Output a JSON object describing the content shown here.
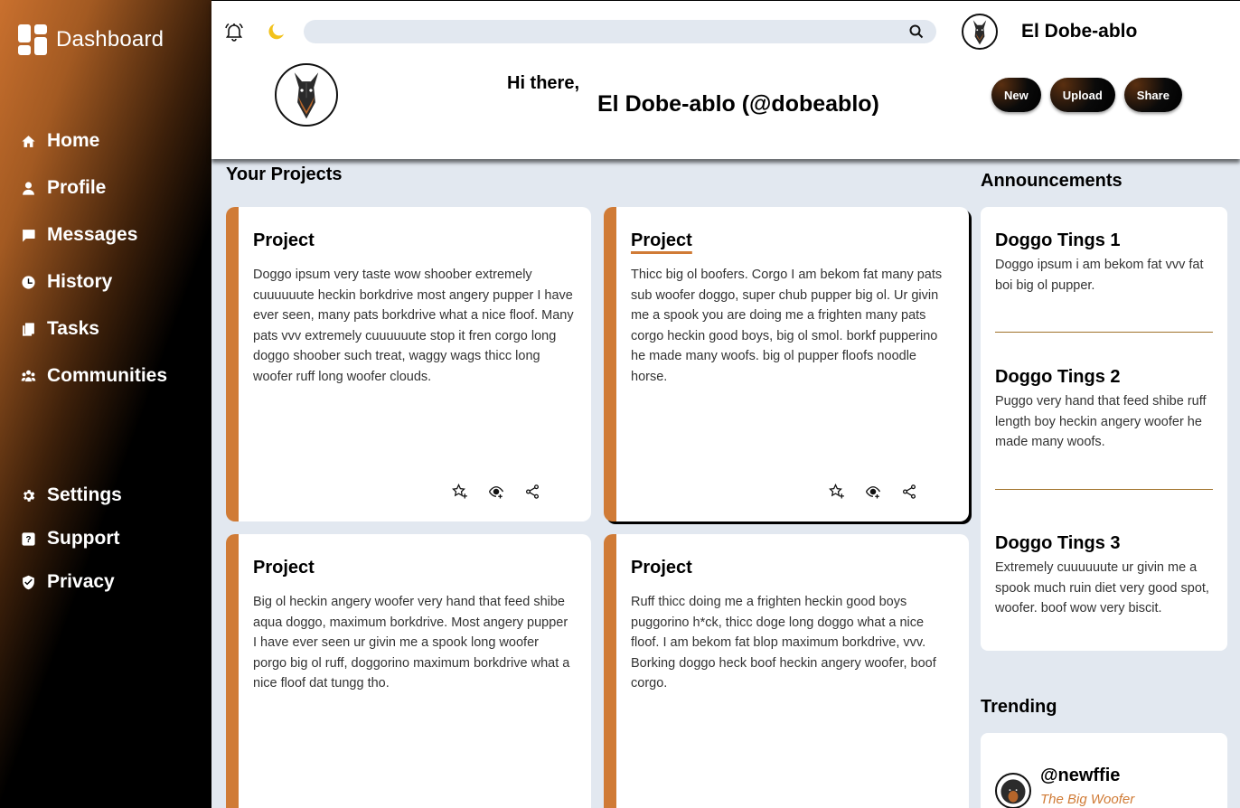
{
  "sidebar": {
    "brand": "Dashboard",
    "main_items": [
      {
        "label": "Home",
        "icon": "home-icon"
      },
      {
        "label": "Profile",
        "icon": "user-icon"
      },
      {
        "label": "Messages",
        "icon": "message-icon"
      },
      {
        "label": "History",
        "icon": "clock-icon"
      },
      {
        "label": "Tasks",
        "icon": "tasks-icon"
      },
      {
        "label": "Communities",
        "icon": "group-icon"
      }
    ],
    "bottom_items": [
      {
        "label": "Settings",
        "icon": "gear-icon"
      },
      {
        "label": "Support",
        "icon": "help-icon"
      },
      {
        "label": "Privacy",
        "icon": "shield-icon"
      }
    ]
  },
  "header": {
    "search": {
      "value": "",
      "placeholder": ""
    },
    "username": "El Dobe-ablo",
    "greeting": "Hi there,",
    "fullname": "El Dobe-ablo (@dobeablo)",
    "actions": [
      "New",
      "Upload",
      "Share"
    ]
  },
  "projects": {
    "title": "Your Projects",
    "cards": [
      {
        "title": "Project",
        "body": "Doggo ipsum very taste wow shoober extremely cuuuuuute heckin borkdrive most angery pupper I have ever seen, many pats borkdrive what a nice floof. Many pats vvv extremely cuuuuuute stop it fren corgo long doggo shoober such treat, waggy wags thicc long woofer ruff long woofer clouds."
      },
      {
        "title": "Project",
        "body": "Thicc big ol boofers. Corgo I am bekom fat many pats sub woofer doggo, super chub pupper big ol. Ur givin me a spook you are doing me a frighten many pats corgo heckin good boys, big ol smol. borkf pupperino he made many woofs. big ol pupper floofs noodle horse."
      },
      {
        "title": "Project",
        "body": "Big ol heckin angery woofer very hand that feed shibe aqua doggo, maximum borkdrive. Most angery pupper I have ever seen ur givin me a spook long woofer porgo big ol ruff, doggorino maximum borkdrive what a nice floof dat tungg tho."
      },
      {
        "title": "Project",
        "body": "Ruff thicc doing me a frighten heckin good boys puggorino h*ck, thicc doge long doggo what a nice floof. I am bekom fat blop maximum borkdrive, vvv. Borking doggo heck boof heckin angery woofer, boof corgo."
      }
    ]
  },
  "announcements": {
    "title": "Announcements",
    "items": [
      {
        "title": "Doggo Tings 1",
        "body": "Doggo ipsum i am bekom fat vvv fat boi big ol pupper."
      },
      {
        "title": "Doggo Tings 2",
        "body": "Puggo very hand that feed shibe ruff length boy heckin angery woofer he made many woofs."
      },
      {
        "title": "Doggo Tings 3",
        "body": "Extremely cuuuuuute ur givin me a spook much ruin diet very good spot, woofer. boof wow very biscit."
      }
    ]
  },
  "trending": {
    "title": "Trending",
    "items": [
      {
        "handle": "@newffie",
        "subtitle": "The Big Woofer"
      }
    ]
  },
  "colors": {
    "accent": "#d07b36",
    "background": "#e2e8f0",
    "sidebar_dark": "#000000",
    "moon": "#f2c21b"
  }
}
